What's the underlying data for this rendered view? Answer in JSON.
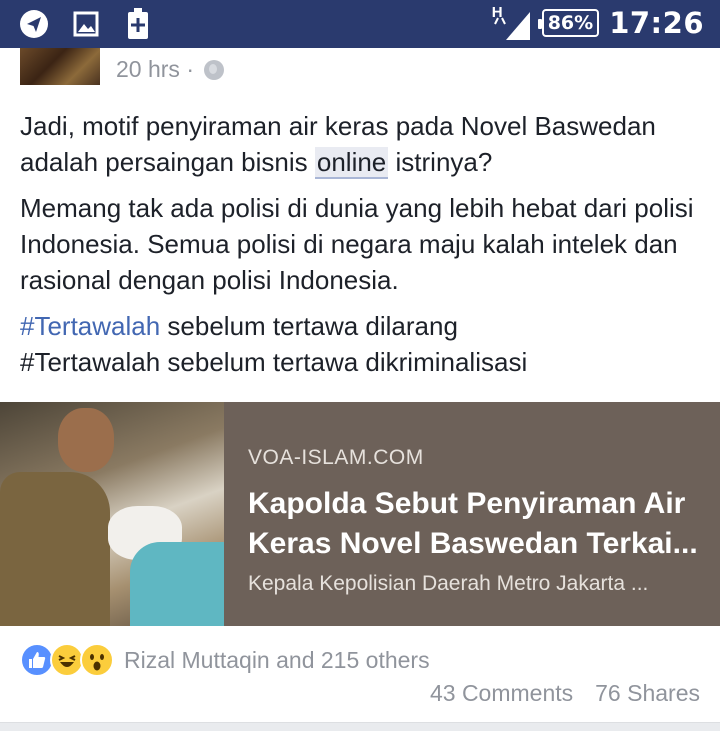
{
  "status_bar": {
    "icons": [
      "telegram-icon",
      "image-icon",
      "battery-saver-icon"
    ],
    "network_label": "H",
    "battery_percent": "86%",
    "time": "17:26"
  },
  "post": {
    "time_ago": "20 hrs ·",
    "privacy_icon": "globe-icon",
    "paragraph1_before": "Jadi, motif penyiraman air keras pada Novel Baswedan adalah persaingan bisnis ",
    "paragraph1_highlight": "online",
    "paragraph1_after": " istrinya?",
    "paragraph2": "Memang tak ada polisi di dunia yang lebih hebat dari polisi Indonesia. Semua polisi di negara maju kalah intelek dan rasional dengan polisi Indonesia.",
    "hashtag1": "#Tertawalah",
    "hashtag1_rest": " sebelum tertawa dilarang",
    "line4": "#Tertawalah sebelum tertawa dikriminalisasi"
  },
  "link_card": {
    "domain": "VOA-ISLAM.COM",
    "title_line1": "Kapolda Sebut Penyiraman Air",
    "title_line2": "Keras Novel Baswedan Terkai...",
    "description": "Kepala Kepolisian Daerah Metro Jakarta ..."
  },
  "footer": {
    "reaction_icons": [
      "like-icon",
      "haha-icon",
      "wow-icon"
    ],
    "reactors": "Rizal Muttaqin and 215 others",
    "comments": "43 Comments",
    "shares": "76 Shares"
  },
  "colors": {
    "status_bar": "#2a3a6e",
    "hashtag": "#4267b2",
    "card_bg": "#6d6159",
    "meta_text": "#90949c"
  }
}
